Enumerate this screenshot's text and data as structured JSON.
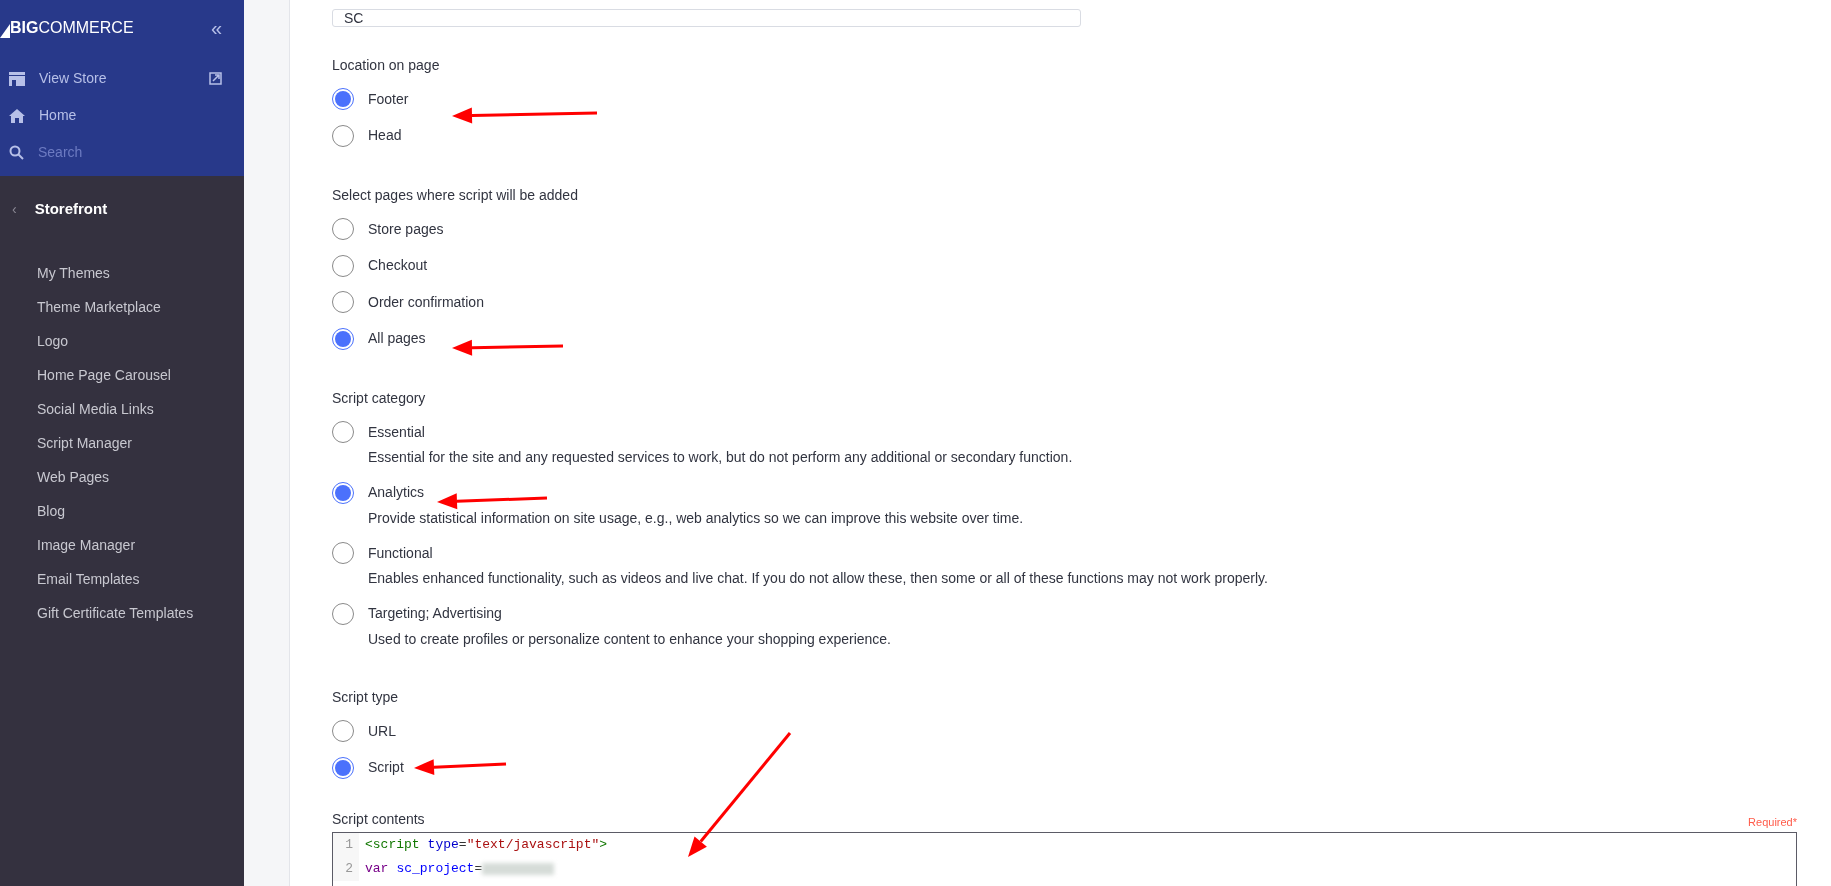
{
  "sidebar": {
    "logo": {
      "mark": "BIG",
      "rest": "COMMERCE"
    },
    "collapse": "«",
    "top_items": [
      {
        "kind": "store",
        "label": "View Store"
      },
      {
        "kind": "home",
        "label": "Home"
      },
      {
        "kind": "search",
        "placeholder": "Search"
      }
    ],
    "back": "‹",
    "section": "Storefront",
    "items": [
      {
        "label": "My Themes"
      },
      {
        "label": "Theme Marketplace"
      },
      {
        "label": "Logo"
      },
      {
        "label": "Home Page Carousel"
      },
      {
        "label": "Social Media Links"
      },
      {
        "label": "Script Manager"
      },
      {
        "label": "Web Pages"
      },
      {
        "label": "Blog"
      },
      {
        "label": "Image Manager"
      },
      {
        "label": "Email Templates"
      },
      {
        "label": "Gift Certificate Templates"
      }
    ]
  },
  "description": {
    "value": "SC"
  },
  "groups": [
    {
      "label": "Location on page",
      "options": [
        {
          "label": "Footer",
          "selected": true
        },
        {
          "label": "Head",
          "selected": false
        }
      ]
    },
    {
      "label": "Select pages where script will be added",
      "options": [
        {
          "label": "Store pages",
          "selected": false
        },
        {
          "label": "Checkout",
          "selected": false
        },
        {
          "label": "Order confirmation",
          "selected": false
        },
        {
          "label": "All pages",
          "selected": true
        }
      ]
    },
    {
      "label": "Script category",
      "options": [
        {
          "label": "Essential",
          "description": "Essential for the site and any requested services to work, but do not perform any additional or secondary function.",
          "selected": false
        },
        {
          "label": "Analytics",
          "description": "Provide statistical information on site usage, e.g., web analytics so we can improve this website over time.",
          "selected": true
        },
        {
          "label": "Functional",
          "description": "Enables enhanced functionality, such as videos and live chat. If you do not allow these, then some or all of these functions may not work properly.",
          "selected": false
        },
        {
          "label": "Targeting; Advertising",
          "description": "Used to create profiles or personalize content to enhance your shopping experience.",
          "selected": false
        }
      ]
    },
    {
      "label": "Script type",
      "options": [
        {
          "label": "URL",
          "selected": false
        },
        {
          "label": "Script",
          "selected": true
        }
      ]
    }
  ],
  "script_contents": {
    "label": "Script contents",
    "required": "Required*",
    "lines": [
      {
        "number": "1",
        "tokens": [
          {
            "kind": "tag",
            "text": "<script"
          },
          {
            "kind": "space"
          },
          {
            "kind": "attribute",
            "text": "type"
          },
          {
            "kind": "plain",
            "text": "="
          },
          {
            "kind": "string",
            "text": "\"text/javascript\""
          },
          {
            "kind": "tag",
            "text": ">"
          }
        ]
      },
      {
        "number": "2",
        "tokens": [
          {
            "kind": "keyword",
            "text": "var"
          },
          {
            "kind": "space"
          },
          {
            "kind": "variable",
            "text": "sc_project"
          },
          {
            "kind": "plain",
            "text": "="
          },
          {
            "kind": "redacted"
          }
        ]
      }
    ]
  }
}
